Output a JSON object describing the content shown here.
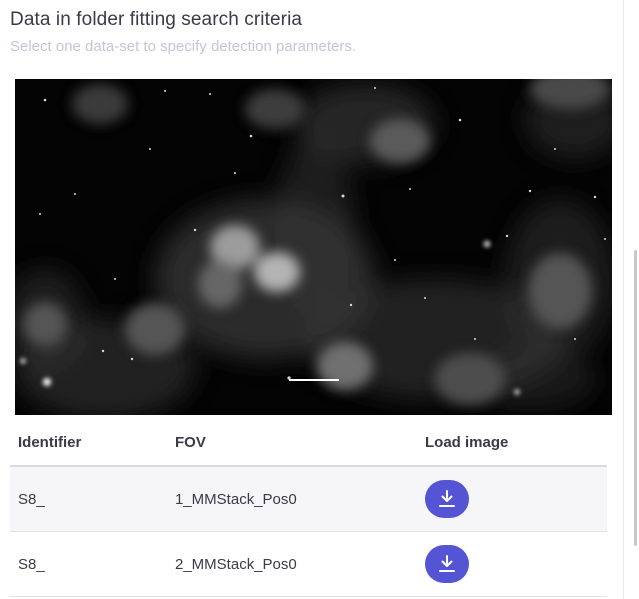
{
  "header": {
    "title": "Data in folder fitting search criteria",
    "subtitle": "Select one data-set to specify detection parameters."
  },
  "table": {
    "columns": [
      "Identifier",
      "FOV",
      "Load image"
    ],
    "rows": [
      {
        "identifier": "S8_",
        "fov": "1_MMStack_Pos0"
      },
      {
        "identifier": "S8_",
        "fov": "2_MMStack_Pos0"
      }
    ]
  },
  "icons": {
    "load": "download-icon"
  },
  "colors": {
    "accent": "#5554d4",
    "text": "#3a3a48",
    "muted": "#c2c6d6"
  }
}
